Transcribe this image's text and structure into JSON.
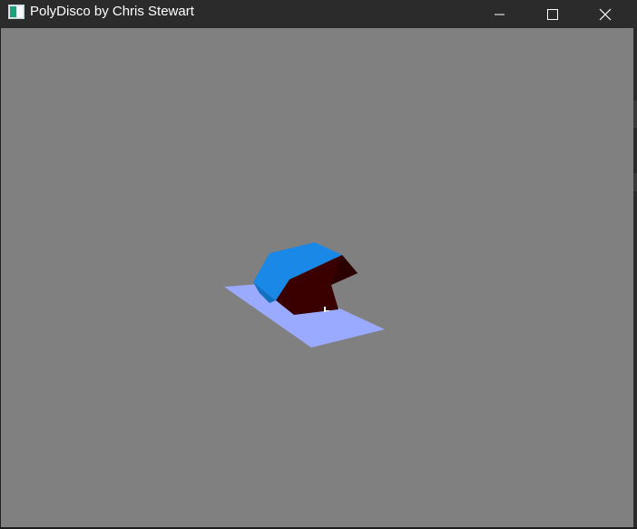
{
  "window": {
    "title": "PolyDisco by Chris Stewart",
    "buttons": {
      "minimize": "minimize-icon",
      "maximize": "maximize-icon",
      "close": "close-icon"
    }
  },
  "scene": {
    "background_color": "#808080",
    "floor_color": "#99aaff",
    "object_top_color": "#1a88e6",
    "object_front_color": "#3a0000",
    "object_side_color": "#2a0000"
  }
}
